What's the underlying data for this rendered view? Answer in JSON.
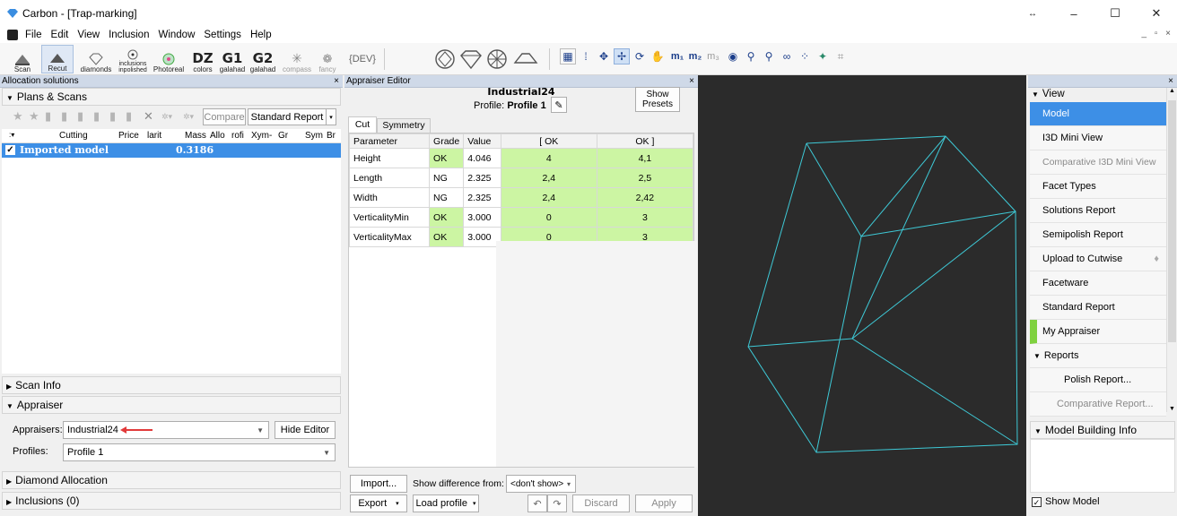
{
  "window": {
    "title": "Carbon - [Trap-marking]"
  },
  "menu": [
    "File",
    "Edit",
    "View",
    "Inclusion",
    "Window",
    "Settings",
    "Help"
  ],
  "toolbar": {
    "buttons": [
      {
        "label": "Scan",
        "icon": "scan-icon"
      },
      {
        "label": "Recut",
        "icon": "recut-icon"
      },
      {
        "label": "diamonds",
        "icon": "diamonds-icon"
      },
      {
        "label": "inclusions inpolished",
        "icon": "inclusions-icon"
      },
      {
        "label": "Photoreal",
        "icon": "photoreal-icon"
      },
      {
        "big": "DZ",
        "label": "colors"
      },
      {
        "big": "G1",
        "label": "galahad"
      },
      {
        "big": "G2",
        "label": "galahad"
      },
      {
        "label": "compass",
        "icon": "compass-icon"
      },
      {
        "label": "fancy",
        "icon": "fancy-icon"
      }
    ],
    "dev_label": "{DEV}"
  },
  "left": {
    "panel_title": "Allocation solutions",
    "plans_label": "Plans & Scans",
    "compare_label": "Compare",
    "standard_report_label": "Standard Report",
    "columns": [
      "Cutting",
      "Price",
      "larit",
      "Mass",
      "Allo",
      "rofi",
      "Xym-",
      "Gr",
      "Sym",
      "Br"
    ],
    "row": {
      "name": "Imported model",
      "mass": "0.3186"
    },
    "scan_info_label": "Scan Info",
    "appraiser_label": "Appraiser",
    "appraisers_label": "Appraisers:",
    "appraiser_value": "Industrial24",
    "hide_editor_label": "Hide Editor",
    "profiles_label": "Profiles:",
    "profile_value": "Profile 1",
    "diamond_allocation_label": "Diamond Allocation",
    "inclusions_label": "Inclusions (0)"
  },
  "editor": {
    "panel_title": "Appraiser Editor",
    "name": "Industrial24",
    "profile_prefix": "Profile:",
    "profile_name": "Profile 1",
    "show_presets_label": "Show Presets",
    "tabs": [
      "Cut",
      "Symmetry"
    ],
    "headers": [
      "Parameter",
      "Grade",
      "Value",
      "[ OK",
      "OK ]"
    ],
    "rows": [
      {
        "param": "Height",
        "grade": "OK",
        "value": "4.046",
        "lo": "4",
        "hi": "4,1"
      },
      {
        "param": "Length",
        "grade": "NG",
        "value": "2.325",
        "lo": "2,4",
        "hi": "2,5"
      },
      {
        "param": "Width",
        "grade": "NG",
        "value": "2.325",
        "lo": "2,4",
        "hi": "2,42"
      },
      {
        "param": "VerticalityMin",
        "grade": "OK",
        "value": "3.000",
        "lo": "0",
        "hi": "3"
      },
      {
        "param": "VerticalityMax",
        "grade": "OK",
        "value": "3.000",
        "lo": "0",
        "hi": "3"
      }
    ],
    "import_label": "Import...",
    "export_label": "Export",
    "show_diff_label": "Show difference from:",
    "show_diff_value": "<don't show>",
    "load_profile_label": "Load profile",
    "discard_label": "Discard",
    "apply_label": "Apply"
  },
  "right": {
    "view_label": "View",
    "items": [
      {
        "label": "Model",
        "state": "selected"
      },
      {
        "label": "I3D Mini View",
        "state": "normal"
      },
      {
        "label": "Comparative I3D Mini View",
        "state": "disabled"
      },
      {
        "label": "Facet Types",
        "state": "normal"
      },
      {
        "label": "Solutions Report",
        "state": "normal"
      },
      {
        "label": "Semipolish Report",
        "state": "normal"
      },
      {
        "label": "Upload to Cutwise",
        "state": "normal"
      },
      {
        "label": "Facetware",
        "state": "normal"
      },
      {
        "label": "Standard Report",
        "state": "normal"
      },
      {
        "label": "My Appraiser",
        "state": "active"
      }
    ],
    "reports_label": "Reports",
    "sub_items": [
      {
        "label": "Polish Report...",
        "state": "normal"
      },
      {
        "label": "Comparative Report...",
        "state": "disabled"
      }
    ],
    "model_building_label": "Model Building Info",
    "show_model_label": "Show Model"
  },
  "colors": {
    "accent": "#3d8fe6",
    "ok_green": "#ccf5a3",
    "viewport": "#2b2b2b",
    "wire": "#3ec9d6"
  }
}
